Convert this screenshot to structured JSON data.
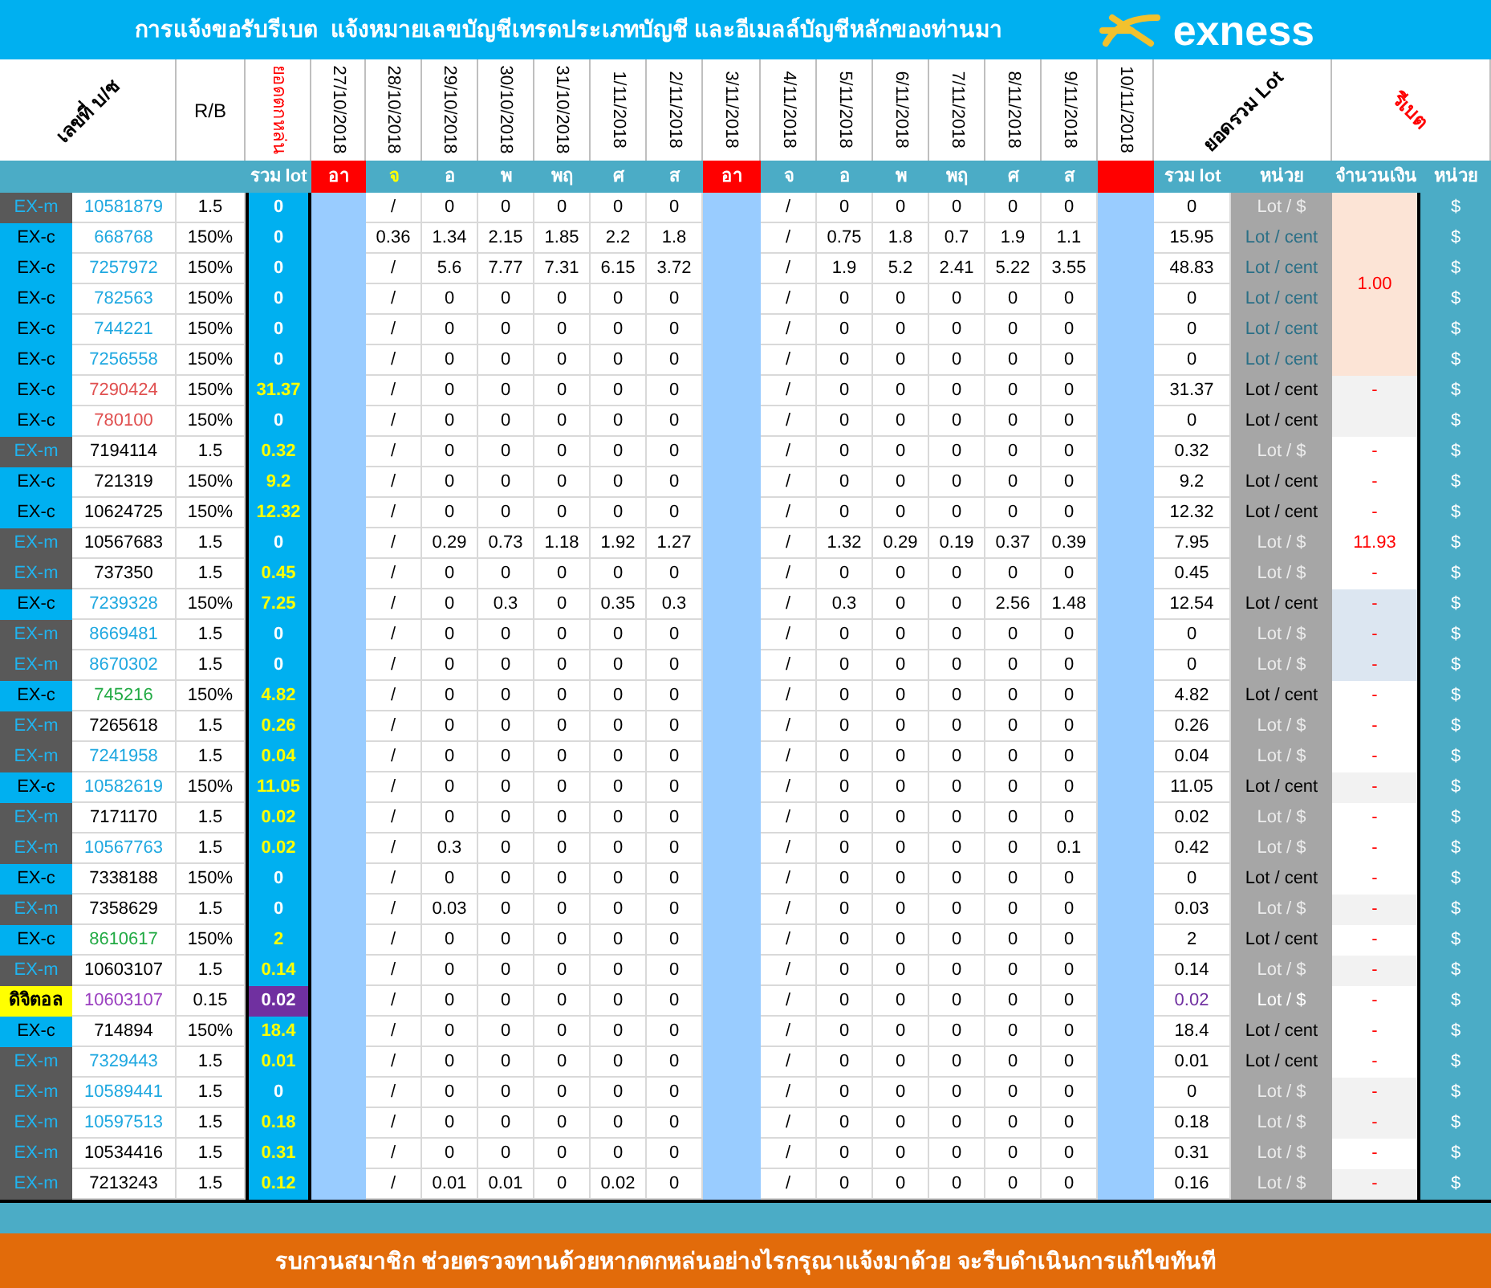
{
  "title": "การแจ้งขอรับรีเบต  แจ้งหมายเลขบัญชีเทรดประเภทบัญชี และอีเมลล์บัญชีหลักของท่านมา",
  "logo": "exness",
  "header": [
    {
      "kind": "diagonal",
      "text": "เลขที่ บ/ช",
      "accent": false
    },
    {
      "kind": "plain",
      "text": "R/B",
      "accent": false
    },
    {
      "kind": "vertical",
      "text": "ยอดตกหล่น",
      "accent": true
    },
    {
      "kind": "vertical",
      "text": "27/10/2018",
      "accent": false
    },
    {
      "kind": "vertical",
      "text": "28/10/2018",
      "accent": false
    },
    {
      "kind": "vertical",
      "text": "29/10/2018",
      "accent": false
    },
    {
      "kind": "vertical",
      "text": "30/10/2018",
      "accent": false
    },
    {
      "kind": "vertical",
      "text": "31/10/2018",
      "accent": false
    },
    {
      "kind": "vertical",
      "text": "1/11/2018",
      "accent": false
    },
    {
      "kind": "vertical",
      "text": "2/11/2018",
      "accent": false
    },
    {
      "kind": "vertical",
      "text": "3/11/2018",
      "accent": false
    },
    {
      "kind": "vertical",
      "text": "4/11/2018",
      "accent": false
    },
    {
      "kind": "vertical",
      "text": "5/11/2018",
      "accent": false
    },
    {
      "kind": "vertical",
      "text": "6/11/2018",
      "accent": false
    },
    {
      "kind": "vertical",
      "text": "7/11/2018",
      "accent": false
    },
    {
      "kind": "vertical",
      "text": "8/11/2018",
      "accent": false
    },
    {
      "kind": "vertical",
      "text": "9/11/2018",
      "accent": false
    },
    {
      "kind": "vertical",
      "text": "10/11/2018",
      "accent": false
    },
    {
      "kind": "diagonal",
      "text": "ยอดรวม Lot",
      "accent": false
    },
    {
      "kind": "diagonal_down",
      "text": "รีเบต",
      "accent": true
    }
  ],
  "day_labels": [
    {
      "kind": "total",
      "text": "รวม lot"
    },
    {
      "kind": "holiday",
      "text": "อา"
    },
    {
      "kind": "day",
      "text": "จ",
      "highlighted": true
    },
    {
      "kind": "day",
      "text": "อ",
      "highlighted": false
    },
    {
      "kind": "day",
      "text": "พ",
      "highlighted": false
    },
    {
      "kind": "day",
      "text": "พฤ",
      "highlighted": false
    },
    {
      "kind": "day",
      "text": "ศ",
      "highlighted": false
    },
    {
      "kind": "day",
      "text": "ส",
      "highlighted": false
    },
    {
      "kind": "holiday",
      "text": "อา"
    },
    {
      "kind": "day",
      "text": "จ",
      "highlighted": false
    },
    {
      "kind": "day",
      "text": "อ",
      "highlighted": false
    },
    {
      "kind": "day",
      "text": "พ",
      "highlighted": false
    },
    {
      "kind": "day",
      "text": "พฤ",
      "highlighted": false
    },
    {
      "kind": "day",
      "text": "ศ",
      "highlighted": false
    },
    {
      "kind": "day",
      "text": "ส",
      "highlighted": false
    },
    {
      "kind": "holiday"
    },
    {
      "kind": "total",
      "text": "รวม lot"
    },
    {
      "kind": "total",
      "text": "หน่วย"
    },
    {
      "kind": "total",
      "text": "จำนวนเงิน"
    },
    {
      "kind": "total",
      "text": "หน่วย"
    }
  ],
  "rows": [
    {
      "kind": "ex_m",
      "type": "EX-m",
      "account": "10581879",
      "color": "#1fa8e0",
      "rb": "1.5",
      "total": {
        "text": "0",
        "kind": "plain"
      },
      "week1": [
        "/",
        "0",
        "0",
        "0",
        "0",
        "0"
      ],
      "week2": [
        "/",
        "0",
        "0",
        "0",
        "0",
        "0"
      ],
      "sum": "0",
      "unit": {
        "text": "Lot / $",
        "kind": "usd"
      },
      "amount": {
        "text": "1.00",
        "kind": "peach"
      },
      "currency": "$"
    },
    {
      "kind": "ex_c",
      "type": "EX-c",
      "account": "668768",
      "color": "#1fa8e0",
      "rb": "150%",
      "total": {
        "text": "0",
        "kind": "plain"
      },
      "week1": [
        "0.36",
        "1.34",
        "2.15",
        "1.85",
        "2.2",
        "1.8"
      ],
      "week2": [
        "/",
        "0.75",
        "1.8",
        "0.7",
        "1.9",
        "1.1"
      ],
      "sum": "15.95",
      "unit": {
        "text": "Lot / cent",
        "kind": "cent_dim"
      },
      "currency": "$"
    },
    {
      "kind": "ex_c",
      "type": "EX-c",
      "account": "7257972",
      "color": "#1fa8e0",
      "rb": "150%",
      "total": {
        "text": "0",
        "kind": "plain"
      },
      "week1": [
        "/",
        "5.6",
        "7.77",
        "7.31",
        "6.15",
        "3.72"
      ],
      "week2": [
        "/",
        "1.9",
        "5.2",
        "2.41",
        "5.22",
        "3.55"
      ],
      "sum": "48.83",
      "unit": {
        "text": "Lot / cent",
        "kind": "cent_dim"
      },
      "currency": "$"
    },
    {
      "kind": "ex_c",
      "type": "EX-c",
      "account": "782563",
      "color": "#1fa8e0",
      "rb": "150%",
      "total": {
        "text": "0",
        "kind": "plain"
      },
      "week1": [
        "/",
        "0",
        "0",
        "0",
        "0",
        "0"
      ],
      "week2": [
        "/",
        "0",
        "0",
        "0",
        "0",
        "0"
      ],
      "sum": "0",
      "unit": {
        "text": "Lot / cent",
        "kind": "cent_dim"
      },
      "currency": "$"
    },
    {
      "kind": "ex_c",
      "type": "EX-c",
      "account": "744221",
      "color": "#1fa8e0",
      "rb": "150%",
      "total": {
        "text": "0",
        "kind": "plain"
      },
      "week1": [
        "/",
        "0",
        "0",
        "0",
        "0",
        "0"
      ],
      "week2": [
        "/",
        "0",
        "0",
        "0",
        "0",
        "0"
      ],
      "sum": "0",
      "unit": {
        "text": "Lot / cent",
        "kind": "cent_dim"
      },
      "currency": "$"
    },
    {
      "kind": "ex_c",
      "type": "EX-c",
      "account": "7256558",
      "color": "#1fa8e0",
      "rb": "150%",
      "total": {
        "text": "0",
        "kind": "plain"
      },
      "week1": [
        "/",
        "0",
        "0",
        "0",
        "0",
        "0"
      ],
      "week2": [
        "/",
        "0",
        "0",
        "0",
        "0",
        "0"
      ],
      "sum": "0",
      "unit": {
        "text": "Lot / cent",
        "kind": "cent_dim"
      },
      "currency": "$"
    },
    {
      "kind": "ex_c",
      "type": "EX-c",
      "account": "7290424",
      "color": "#e05050",
      "rb": "150%",
      "total": {
        "text": "31.37",
        "kind": "yellow"
      },
      "week1": [
        "/",
        "0",
        "0",
        "0",
        "0",
        "0"
      ],
      "week2": [
        "/",
        "0",
        "0",
        "0",
        "0",
        "0"
      ],
      "sum": "31.37",
      "unit": {
        "text": "Lot / cent",
        "kind": "cent"
      },
      "amount": {
        "text": "-",
        "kind": "gray"
      },
      "currency": "$"
    },
    {
      "kind": "ex_c",
      "type": "EX-c",
      "account": "780100",
      "color": "#e05050",
      "rb": "150%",
      "total": {
        "text": "0",
        "kind": "plain"
      },
      "week1": [
        "/",
        "0",
        "0",
        "0",
        "0",
        "0"
      ],
      "week2": [
        "/",
        "0",
        "0",
        "0",
        "0",
        "0"
      ],
      "sum": "0",
      "unit": {
        "text": "Lot / cent",
        "kind": "cent"
      },
      "amount": {
        "kind": "gray"
      },
      "currency": "$"
    },
    {
      "kind": "ex_m",
      "type": "EX-m",
      "account": "7194114",
      "color": "#000000",
      "rb": "1.5",
      "total": {
        "text": "0.32",
        "kind": "yellow"
      },
      "week1": [
        "/",
        "0",
        "0",
        "0",
        "0",
        "0"
      ],
      "week2": [
        "/",
        "0",
        "0",
        "0",
        "0",
        "0"
      ],
      "sum": "0.32",
      "unit": {
        "text": "Lot / $",
        "kind": "usd"
      },
      "amount": {
        "text": "-",
        "kind": "white"
      },
      "currency": "$"
    },
    {
      "kind": "ex_c",
      "type": "EX-c",
      "account": "721319",
      "color": "#000000",
      "rb": "150%",
      "total": {
        "text": "9.2",
        "kind": "yellow"
      },
      "week1": [
        "/",
        "0",
        "0",
        "0",
        "0",
        "0"
      ],
      "week2": [
        "/",
        "0",
        "0",
        "0",
        "0",
        "0"
      ],
      "sum": "9.2",
      "unit": {
        "text": "Lot / cent",
        "kind": "cent"
      },
      "amount": {
        "text": "-",
        "kind": "white"
      },
      "currency": "$"
    },
    {
      "kind": "ex_c",
      "type": "EX-c",
      "account": "10624725",
      "color": "#000000",
      "rb": "150%",
      "total": {
        "text": "12.32",
        "kind": "yellow"
      },
      "week1": [
        "/",
        "0",
        "0",
        "0",
        "0",
        "0"
      ],
      "week2": [
        "/",
        "0",
        "0",
        "0",
        "0",
        "0"
      ],
      "sum": "12.32",
      "unit": {
        "text": "Lot / cent",
        "kind": "cent"
      },
      "amount": {
        "text": "-",
        "kind": "white"
      },
      "currency": "$"
    },
    {
      "kind": "ex_m",
      "type": "EX-m",
      "account": "10567683",
      "color": "#000000",
      "rb": "1.5",
      "total": {
        "text": "0",
        "kind": "plain"
      },
      "week1": [
        "/",
        "0.29",
        "0.73",
        "1.18",
        "1.92",
        "1.27"
      ],
      "week2": [
        "/",
        "1.32",
        "0.29",
        "0.19",
        "0.37",
        "0.39"
      ],
      "sum": "7.95",
      "unit": {
        "text": "Lot / $",
        "kind": "usd"
      },
      "amount": {
        "text": "11.93",
        "kind": "white"
      },
      "currency": "$"
    },
    {
      "kind": "ex_m",
      "type": "EX-m",
      "account": "737350",
      "color": "#000000",
      "rb": "1.5",
      "total": {
        "text": "0.45",
        "kind": "yellow"
      },
      "week1": [
        "/",
        "0",
        "0",
        "0",
        "0",
        "0"
      ],
      "week2": [
        "/",
        "0",
        "0",
        "0",
        "0",
        "0"
      ],
      "sum": "0.45",
      "unit": {
        "text": "Lot / $",
        "kind": "usd"
      },
      "amount": {
        "text": "-",
        "kind": "white"
      },
      "currency": "$"
    },
    {
      "kind": "ex_c",
      "type": "EX-c",
      "account": "7239328",
      "color": "#1fa8e0",
      "rb": "150%",
      "total": {
        "text": "7.25",
        "kind": "yellow"
      },
      "week1": [
        "/",
        "0",
        "0.3",
        "0",
        "0.35",
        "0.3"
      ],
      "week2": [
        "/",
        "0.3",
        "0",
        "0",
        "2.56",
        "1.48"
      ],
      "sum": "12.54",
      "unit": {
        "text": "Lot / cent",
        "kind": "cent"
      },
      "amount": {
        "text": "-",
        "kind": "bluegray"
      },
      "currency": "$"
    },
    {
      "kind": "ex_m",
      "type": "EX-m",
      "account": "8669481",
      "color": "#1fa8e0",
      "rb": "1.5",
      "total": {
        "text": "0",
        "kind": "plain"
      },
      "week1": [
        "/",
        "0",
        "0",
        "0",
        "0",
        "0"
      ],
      "week2": [
        "/",
        "0",
        "0",
        "0",
        "0",
        "0"
      ],
      "sum": "0",
      "unit": {
        "text": "Lot / $",
        "kind": "usd"
      },
      "amount": {
        "text": "-",
        "kind": "bluegray"
      },
      "currency": "$"
    },
    {
      "kind": "ex_m",
      "type": "EX-m",
      "account": "8670302",
      "color": "#1fa8e0",
      "rb": "1.5",
      "total": {
        "text": "0",
        "kind": "plain"
      },
      "week1": [
        "/",
        "0",
        "0",
        "0",
        "0",
        "0"
      ],
      "week2": [
        "/",
        "0",
        "0",
        "0",
        "0",
        "0"
      ],
      "sum": "0",
      "unit": {
        "text": "Lot / $",
        "kind": "usd"
      },
      "amount": {
        "text": "-",
        "kind": "bluegray"
      },
      "currency": "$"
    },
    {
      "kind": "ex_c",
      "type": "EX-c",
      "account": "745216",
      "color": "#22aa44",
      "rb": "150%",
      "total": {
        "text": "4.82",
        "kind": "yellow"
      },
      "week1": [
        "/",
        "0",
        "0",
        "0",
        "0",
        "0"
      ],
      "week2": [
        "/",
        "0",
        "0",
        "0",
        "0",
        "0"
      ],
      "sum": "4.82",
      "unit": {
        "text": "Lot / cent",
        "kind": "cent"
      },
      "amount": {
        "text": "-",
        "kind": "white"
      },
      "currency": "$"
    },
    {
      "kind": "ex_m",
      "type": "EX-m",
      "account": "7265618",
      "color": "#000000",
      "rb": "1.5",
      "total": {
        "text": "0.26",
        "kind": "yellow"
      },
      "week1": [
        "/",
        "0",
        "0",
        "0",
        "0",
        "0"
      ],
      "week2": [
        "/",
        "0",
        "0",
        "0",
        "0",
        "0"
      ],
      "sum": "0.26",
      "unit": {
        "text": "Lot / $",
        "kind": "usd"
      },
      "amount": {
        "text": "-",
        "kind": "white"
      },
      "currency": "$"
    },
    {
      "kind": "ex_m",
      "type": "EX-m",
      "account": "7241958",
      "color": "#1fa8e0",
      "rb": "1.5",
      "total": {
        "text": "0.04",
        "kind": "yellow"
      },
      "week1": [
        "/",
        "0",
        "0",
        "0",
        "0",
        "0"
      ],
      "week2": [
        "/",
        "0",
        "0",
        "0",
        "0",
        "0"
      ],
      "sum": "0.04",
      "unit": {
        "text": "Lot / $",
        "kind": "usd"
      },
      "amount": {
        "text": "-",
        "kind": "white"
      },
      "currency": "$"
    },
    {
      "kind": "ex_c",
      "type": "EX-c",
      "account": "10582619",
      "color": "#1fa8e0",
      "rb": "150%",
      "total": {
        "text": "11.05",
        "kind": "yellow"
      },
      "week1": [
        "/",
        "0",
        "0",
        "0",
        "0",
        "0"
      ],
      "week2": [
        "/",
        "0",
        "0",
        "0",
        "0",
        "0"
      ],
      "sum": "11.05",
      "unit": {
        "text": "Lot / cent",
        "kind": "cent"
      },
      "amount": {
        "text": "-",
        "kind": "gray"
      },
      "currency": "$"
    },
    {
      "kind": "ex_m",
      "type": "EX-m",
      "account": "7171170",
      "color": "#000000",
      "rb": "1.5",
      "total": {
        "text": "0.02",
        "kind": "yellow"
      },
      "week1": [
        "/",
        "0",
        "0",
        "0",
        "0",
        "0"
      ],
      "week2": [
        "/",
        "0",
        "0",
        "0",
        "0",
        "0"
      ],
      "sum": "0.02",
      "unit": {
        "text": "Lot / $",
        "kind": "usd"
      },
      "amount": {
        "text": "-",
        "kind": "white"
      },
      "currency": "$"
    },
    {
      "kind": "ex_m",
      "type": "EX-m",
      "account": "10567763",
      "color": "#1fa8e0",
      "rb": "1.5",
      "total": {
        "text": "0.02",
        "kind": "yellow"
      },
      "week1": [
        "/",
        "0.3",
        "0",
        "0",
        "0",
        "0"
      ],
      "week2": [
        "/",
        "0",
        "0",
        "0",
        "0",
        "0.1"
      ],
      "sum": "0.42",
      "unit": {
        "text": "Lot / $",
        "kind": "usd"
      },
      "amount": {
        "text": "-",
        "kind": "white"
      },
      "currency": "$"
    },
    {
      "kind": "ex_c",
      "type": "EX-c",
      "account": "7338188",
      "color": "#000000",
      "rb": "150%",
      "total": {
        "text": "0",
        "kind": "plain"
      },
      "week1": [
        "/",
        "0",
        "0",
        "0",
        "0",
        "0"
      ],
      "week2": [
        "/",
        "0",
        "0",
        "0",
        "0",
        "0"
      ],
      "sum": "0",
      "unit": {
        "text": "Lot / cent",
        "kind": "cent"
      },
      "amount": {
        "text": "-",
        "kind": "white"
      },
      "currency": "$"
    },
    {
      "kind": "ex_m",
      "type": "EX-m",
      "account": "7358629",
      "color": "#000000",
      "rb": "1.5",
      "total": {
        "text": "0",
        "kind": "plain"
      },
      "week1": [
        "/",
        "0.03",
        "0",
        "0",
        "0",
        "0"
      ],
      "week2": [
        "/",
        "0",
        "0",
        "0",
        "0",
        "0"
      ],
      "sum": "0.03",
      "unit": {
        "text": "Lot / $",
        "kind": "usd"
      },
      "amount": {
        "text": "-",
        "kind": "gray"
      },
      "currency": "$"
    },
    {
      "kind": "ex_c",
      "type": "EX-c",
      "account": "8610617",
      "color": "#22aa44",
      "rb": "150%",
      "total": {
        "text": "2",
        "kind": "yellow"
      },
      "week1": [
        "/",
        "0",
        "0",
        "0",
        "0",
        "0"
      ],
      "week2": [
        "/",
        "0",
        "0",
        "0",
        "0",
        "0"
      ],
      "sum": "2",
      "unit": {
        "text": "Lot / cent",
        "kind": "cent"
      },
      "amount": {
        "text": "-",
        "kind": "white"
      },
      "currency": "$"
    },
    {
      "kind": "ex_m",
      "type": "EX-m",
      "account": "10603107",
      "color": "#000000",
      "rb": "1.5",
      "total": {
        "text": "0.14",
        "kind": "yellow"
      },
      "week1": [
        "/",
        "0",
        "0",
        "0",
        "0",
        "0"
      ],
      "week2": [
        "/",
        "0",
        "0",
        "0",
        "0",
        "0"
      ],
      "sum": "0.14",
      "unit": {
        "text": "Lot / $",
        "kind": "usd"
      },
      "amount": {
        "text": "-",
        "kind": "gray"
      },
      "currency": "$"
    },
    {
      "kind": "digital",
      "type": "ดิจิตอล",
      "account": "10603107",
      "color": "#9b40c0",
      "rb": "0.15",
      "total": {
        "text": "0.02",
        "kind": "purple"
      },
      "week1": [
        "/",
        "0",
        "0",
        "0",
        "0",
        "0"
      ],
      "week2": [
        "/",
        "0",
        "0",
        "0",
        "0",
        "0"
      ],
      "sum": "0.02",
      "unit": {
        "text": "Lot / $",
        "kind": "highlight"
      },
      "amount": {
        "text": "-",
        "kind": "white"
      },
      "currency": "$"
    },
    {
      "kind": "ex_c",
      "type": "EX-c",
      "account": "714894",
      "color": "#000000",
      "rb": "150%",
      "total": {
        "text": "18.4",
        "kind": "yellow"
      },
      "week1": [
        "/",
        "0",
        "0",
        "0",
        "0",
        "0"
      ],
      "week2": [
        "/",
        "0",
        "0",
        "0",
        "0",
        "0"
      ],
      "sum": "18.4",
      "unit": {
        "text": "Lot / cent",
        "kind": "cent"
      },
      "amount": {
        "text": "-",
        "kind": "white"
      },
      "currency": "$"
    },
    {
      "kind": "ex_m",
      "type": "EX-m",
      "account": "7329443",
      "color": "#1fa8e0",
      "rb": "1.5",
      "total": {
        "text": "0.01",
        "kind": "yellow"
      },
      "week1": [
        "/",
        "0",
        "0",
        "0",
        "0",
        "0"
      ],
      "week2": [
        "/",
        "0",
        "0",
        "0",
        "0",
        "0"
      ],
      "sum": "0.01",
      "unit": {
        "text": "Lot / cent",
        "kind": "cent"
      },
      "amount": {
        "text": "-",
        "kind": "white"
      },
      "currency": "$"
    },
    {
      "kind": "ex_m",
      "type": "EX-m",
      "account": "10589441",
      "color": "#1fa8e0",
      "rb": "1.5",
      "total": {
        "text": "0",
        "kind": "plain"
      },
      "week1": [
        "/",
        "0",
        "0",
        "0",
        "0",
        "0"
      ],
      "week2": [
        "/",
        "0",
        "0",
        "0",
        "0",
        "0"
      ],
      "sum": "0",
      "unit": {
        "text": "Lot / $",
        "kind": "usd"
      },
      "amount": {
        "text": "-",
        "kind": "gray"
      },
      "currency": "$"
    },
    {
      "kind": "ex_m",
      "type": "EX-m",
      "account": "10597513",
      "color": "#1fa8e0",
      "rb": "1.5",
      "total": {
        "text": "0.18",
        "kind": "yellow"
      },
      "week1": [
        "/",
        "0",
        "0",
        "0",
        "0",
        "0"
      ],
      "week2": [
        "/",
        "0",
        "0",
        "0",
        "0",
        "0"
      ],
      "sum": "0.18",
      "unit": {
        "text": "Lot / $",
        "kind": "usd"
      },
      "amount": {
        "text": "-",
        "kind": "gray"
      },
      "currency": "$"
    },
    {
      "kind": "ex_m",
      "type": "EX-m",
      "account": "10534416",
      "color": "#000000",
      "rb": "1.5",
      "total": {
        "text": "0.31",
        "kind": "yellow"
      },
      "week1": [
        "/",
        "0",
        "0",
        "0",
        "0",
        "0"
      ],
      "week2": [
        "/",
        "0",
        "0",
        "0",
        "0",
        "0"
      ],
      "sum": "0.31",
      "unit": {
        "text": "Lot / $",
        "kind": "usd"
      },
      "amount": {
        "text": "-",
        "kind": "white"
      },
      "currency": "$"
    },
    {
      "kind": "ex_m",
      "type": "EX-m",
      "account": "7213243",
      "color": "#000000",
      "rb": "1.5",
      "total": {
        "text": "0.12",
        "kind": "yellow"
      },
      "week1": [
        "/",
        "0.01",
        "0.01",
        "0",
        "0.02",
        "0"
      ],
      "week2": [
        "/",
        "0",
        "0",
        "0",
        "0",
        "0"
      ],
      "sum": "0.16",
      "unit": {
        "text": "Lot / $",
        "kind": "usd"
      },
      "amount": {
        "text": "-",
        "kind": "gray"
      },
      "currency": "$"
    }
  ],
  "footer": "รบกวนสมาชิก ช่วยตรวจทานด้วยหากตกหล่นอย่างไรกรุณาแจ้งมาด้วย จะรีบดำเนินการแก้ไขทันที"
}
